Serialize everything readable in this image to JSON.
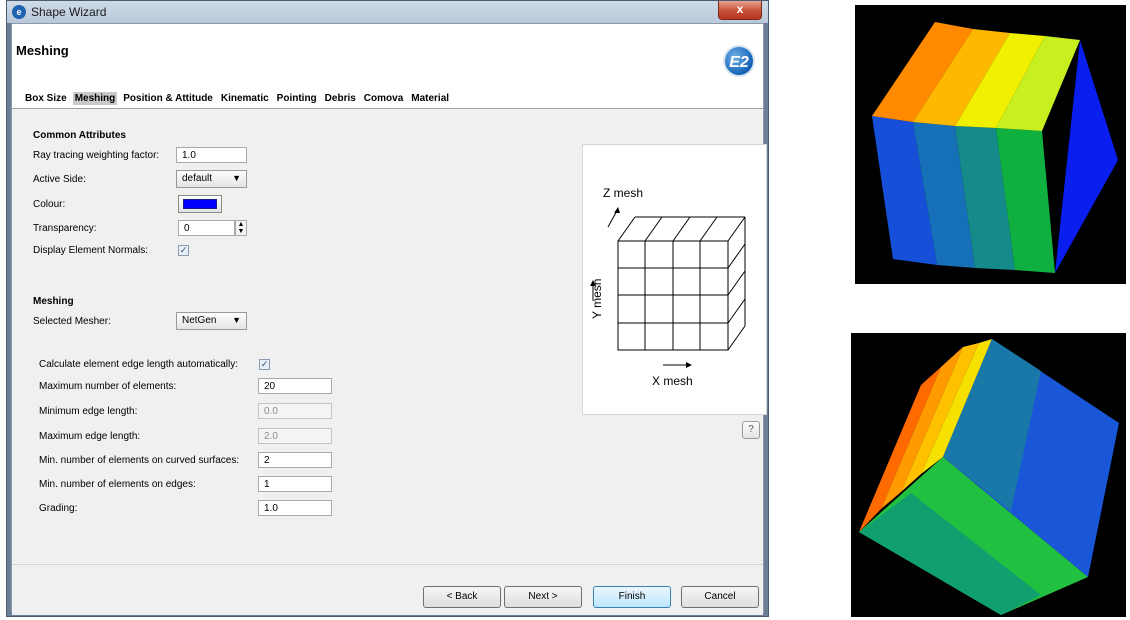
{
  "window": {
    "title": "Shape Wizard",
    "close_label": "x"
  },
  "header": {
    "page_title": "Meshing",
    "logo_text": "E2"
  },
  "tabs": [
    {
      "label": "Box Size"
    },
    {
      "label": "Meshing"
    },
    {
      "label": "Position & Attitude"
    },
    {
      "label": "Kinematic"
    },
    {
      "label": "Pointing"
    },
    {
      "label": "Debris"
    },
    {
      "label": "Comova"
    },
    {
      "label": "Material"
    }
  ],
  "common": {
    "section_title": "Common Attributes",
    "ray_label": "Ray tracing weighting factor:",
    "ray_value": "1.0",
    "active_side_label": "Active Side:",
    "active_side_value": "default",
    "colour_label": "Colour:",
    "colour_value": "#0000ff",
    "transparency_label": "Transparency:",
    "transparency_value": "0",
    "normals_label": "Display Element Normals:",
    "normals_checked": true
  },
  "meshing": {
    "section_title": "Meshing",
    "mesher_label": "Selected Mesher:",
    "mesher_value": "NetGen",
    "auto_label": "Calculate element edge length automatically:",
    "auto_checked": true,
    "max_elements_label": "Maximum number of elements:",
    "max_elements_value": "20",
    "min_edge_label": "Minimum edge length:",
    "min_edge_value": "0.0",
    "max_edge_label": "Maximum edge length:",
    "max_edge_value": "2.0",
    "curved_label": "Min. number of elements on curved surfaces:",
    "curved_value": "2",
    "edges_label": "Min. number of elements on edges:",
    "edges_value": "1",
    "grading_label": "Grading:",
    "grading_value": "1.0"
  },
  "diagram": {
    "z_label": "Z mesh",
    "y_label": "Y mesh",
    "x_label": "X mesh"
  },
  "help_label": "?",
  "buttons": {
    "back": "< Back",
    "next": "Next >",
    "finish": "Finish",
    "cancel": "Cancel"
  },
  "colors": {
    "accent": "#1563b5",
    "mesh_blue": "#0000ff"
  }
}
